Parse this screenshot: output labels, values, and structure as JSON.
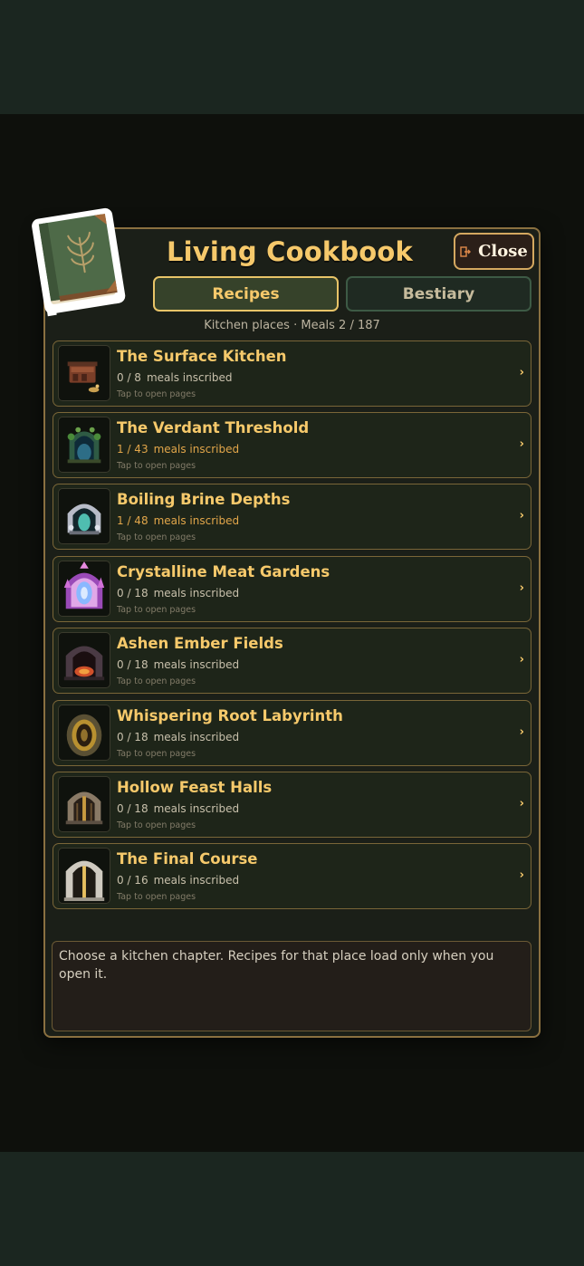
{
  "title": "Living Cookbook",
  "close_label": "Close",
  "tabs": [
    {
      "label": "Recipes",
      "active": true
    },
    {
      "label": "Bestiary",
      "active": false
    }
  ],
  "subtitle": "Kitchen places  ·  Meals  2 / 187",
  "chevron": "›",
  "chapters": [
    {
      "title": "The Surface Kitchen",
      "count": "0 / 8",
      "suffix": "meals inscribed",
      "hint": "Tap to open pages",
      "active": false
    },
    {
      "title": "The Verdant Threshold",
      "count": "1 / 43",
      "suffix": "meals inscribed",
      "hint": "Tap to open pages",
      "active": true
    },
    {
      "title": "Boiling Brine Depths",
      "count": "1 / 48",
      "suffix": "meals inscribed",
      "hint": "Tap to open pages",
      "active": true
    },
    {
      "title": "Crystalline Meat Gardens",
      "count": "0 / 18",
      "suffix": "meals inscribed",
      "hint": "Tap to open pages",
      "active": false
    },
    {
      "title": "Ashen Ember Fields",
      "count": "0 / 18",
      "suffix": "meals inscribed",
      "hint": "Tap to open pages",
      "active": false
    },
    {
      "title": "Whispering Root Labyrinth",
      "count": "0 / 18",
      "suffix": "meals inscribed",
      "hint": "Tap to open pages",
      "active": false
    },
    {
      "title": "Hollow Feast Halls",
      "count": "0 / 18",
      "suffix": "meals inscribed",
      "hint": "Tap to open pages",
      "active": false
    },
    {
      "title": "The Final Course",
      "count": "0 / 16",
      "suffix": "meals inscribed",
      "hint": "Tap to open pages",
      "active": false
    }
  ],
  "info_text": "Choose a kitchen chapter. Recipes for that place load only when you open it.",
  "colors": {
    "accent_gold": "#f6c96b",
    "active_count": "#e2a64a",
    "panel_bg": "#1b1f18",
    "border": "#8a7040"
  }
}
